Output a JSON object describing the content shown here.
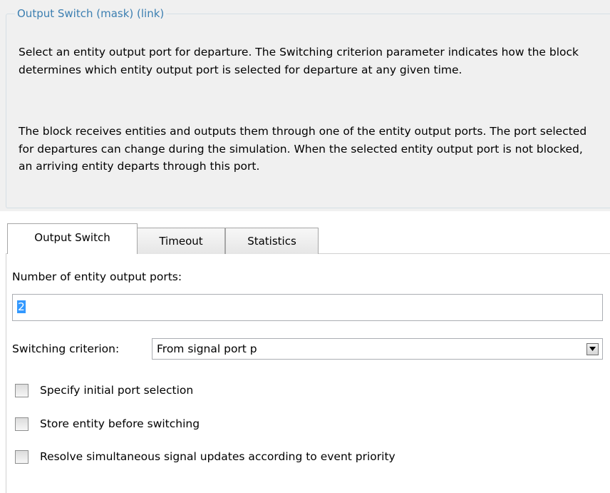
{
  "mask": {
    "title": "Output Switch (mask) (link)",
    "description": [
      "Select an entity output port for departure. The Switching criterion parameter indicates how the block determines which entity output port is selected for departure at any given time.",
      "The block receives entities and outputs them through one of the entity output ports. The port selected for departures can change during the simulation. When the selected entity output port is not blocked, an arriving entity departs through this port."
    ]
  },
  "tabs": [
    {
      "label": "Output Switch",
      "active": true
    },
    {
      "label": "Timeout",
      "active": false
    },
    {
      "label": "Statistics",
      "active": false
    }
  ],
  "params": {
    "ports_label": "Number of entity output ports:",
    "ports_value": "2",
    "criterion_label": "Switching criterion:",
    "criterion_value": "From signal port p",
    "checkboxes": [
      {
        "label": "Specify initial port selection",
        "checked": false
      },
      {
        "label": "Store entity before switching",
        "checked": false
      },
      {
        "label": "Resolve simultaneous signal updates according to event priority",
        "checked": false
      }
    ]
  },
  "colors": {
    "legend": "#3c7fb1",
    "panel_bg": "#f0f0f0",
    "selection": "#3399ff"
  }
}
